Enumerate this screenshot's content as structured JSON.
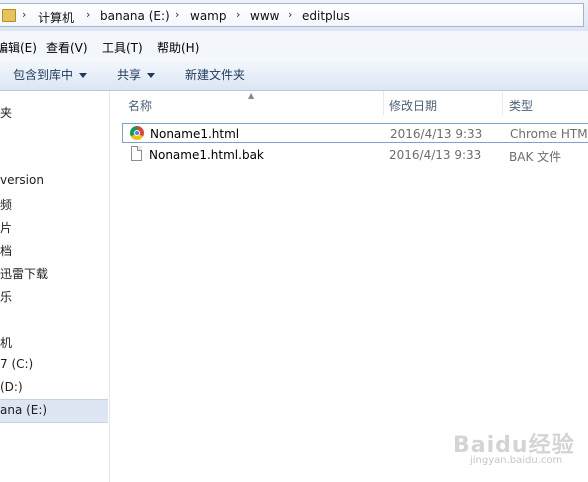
{
  "address": {
    "crumbs": [
      "计算机",
      "banana (E:)",
      "wamp",
      "www",
      "editplus"
    ],
    "separator": "›"
  },
  "menu": {
    "items": [
      "编辑(E)",
      "查看(V)",
      "工具(T)",
      "帮助(H)"
    ]
  },
  "toolbar": {
    "include_library": "包含到库中",
    "share": "共享",
    "new_folder": "新建文件夹"
  },
  "nav": {
    "items": [
      "夹",
      "version",
      "频",
      "片",
      "档",
      "迅雷下载",
      "乐",
      "机",
      "7 (C:)",
      "(D:)",
      "ana (E:)"
    ]
  },
  "columns": {
    "name": "名称",
    "date": "修改日期",
    "type": "类型"
  },
  "files": [
    {
      "name": "Noname1.html",
      "date": "2016/4/13 9:33",
      "type": "Chrome HTML",
      "icon": "chrome-icon"
    },
    {
      "name": "Noname1.html.bak",
      "date": "2016/4/13 9:33",
      "type": "BAK 文件",
      "icon": "file-icon"
    }
  ],
  "watermark": {
    "logo": "Baidu经验",
    "url": "jingyan.baidu.com"
  }
}
